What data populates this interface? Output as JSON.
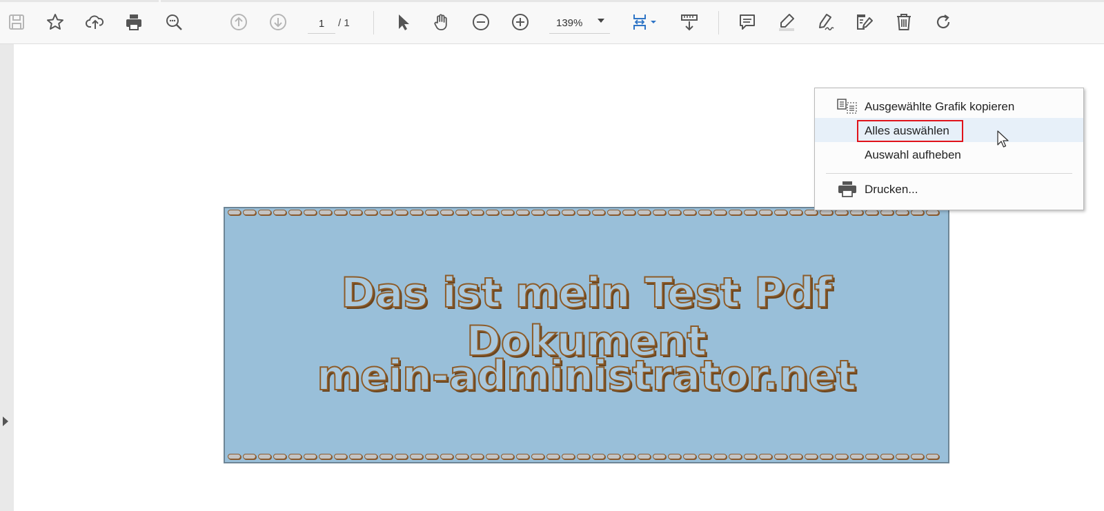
{
  "toolbar": {
    "buttons": [
      {
        "name": "save-icon"
      },
      {
        "name": "bookmark-star-icon"
      },
      {
        "name": "cloud-upload-icon"
      },
      {
        "name": "print-icon"
      },
      {
        "name": "search-zoom-icon"
      },
      {
        "name": "previous-page-icon"
      },
      {
        "name": "next-page-icon"
      },
      {
        "name": "select-cursor-icon"
      },
      {
        "name": "hand-tool-icon"
      },
      {
        "name": "zoom-out-icon"
      },
      {
        "name": "zoom-in-icon"
      },
      {
        "name": "fit-page-icon"
      },
      {
        "name": "scroll-mode-icon"
      },
      {
        "name": "comment-icon"
      },
      {
        "name": "highlight-icon"
      },
      {
        "name": "sign-icon"
      },
      {
        "name": "edit-text-icon"
      },
      {
        "name": "delete-icon"
      },
      {
        "name": "rotate-icon"
      }
    ],
    "page_current": "1",
    "page_total": "/ 1",
    "zoom": "139%",
    "accent_color": "#2d74c6"
  },
  "document": {
    "line1": "Das ist mein Test Pdf Dokument",
    "line2": "mein-administrator.net",
    "background_color": "#99bfd9",
    "text_color": "#8d5b28"
  },
  "context_menu": {
    "items": [
      {
        "label": "Ausgewählte Grafik kopieren",
        "icon": "copy-graphic-icon"
      },
      {
        "label": "Alles auswählen",
        "highlighted": true
      },
      {
        "label": "Auswahl aufheben"
      },
      {
        "label": "Drucken...",
        "icon": "print-icon"
      }
    ],
    "highlight_color": "#e0121a"
  }
}
